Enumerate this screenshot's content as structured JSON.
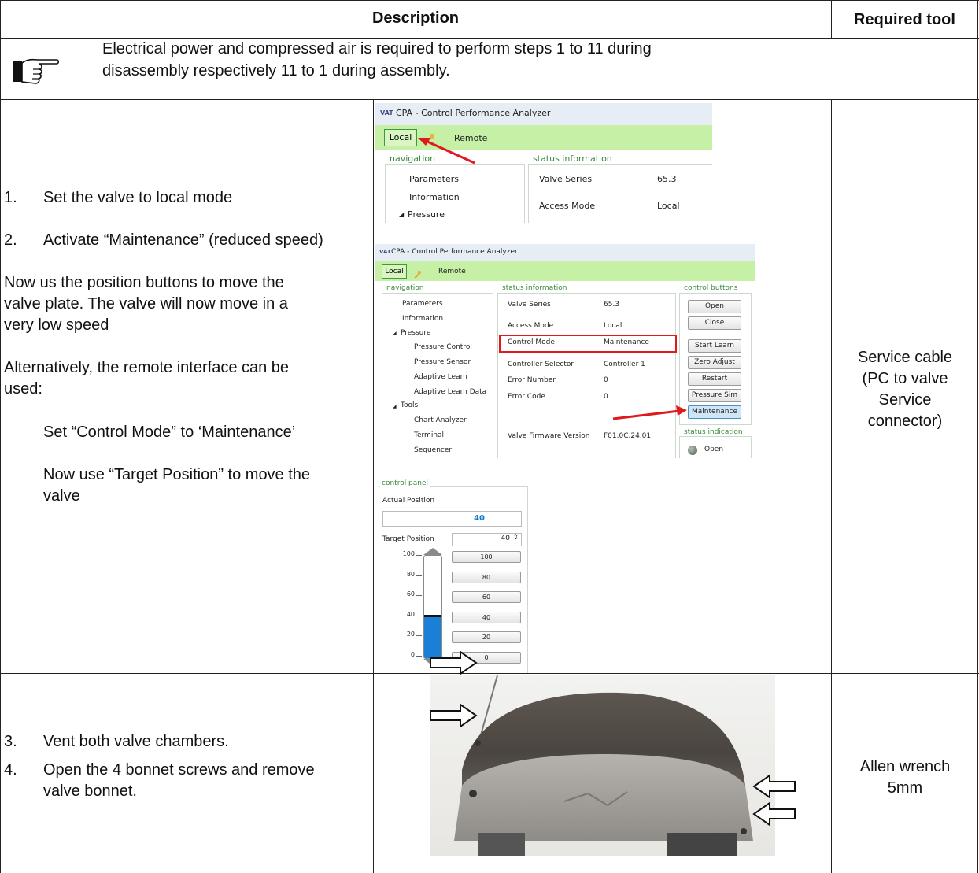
{
  "header": {
    "description": "Description",
    "required_tool": "Required tool"
  },
  "note": {
    "icon": "pointing-hand-icon",
    "line1": "Electrical power and compressed air is required to perform steps 1 to 11 during",
    "line2": "disassembly respectively 11 to 1 during assembly."
  },
  "row2": {
    "step1_num": "1.",
    "step1": "Set the valve to local mode",
    "step2_num": "2.",
    "step2": "Activate “Maintenance” (reduced speed)",
    "para1_l1": "Now us the position buttons to move the",
    "para1_l2": "valve plate. The valve will now move in a",
    "para1_l3": "very low speed",
    "para2_l1": "Alternatively, the remote interface can be",
    "para2_l2": "used:",
    "set_line": "Set “Control Mode” to ‘Maintenance’",
    "use_l1": "Now use “Target Position” to move the",
    "use_l2": "valve",
    "tool_l1": "Service cable",
    "tool_l2": "(PC to valve",
    "tool_l3": "Service",
    "tool_l4": "connector)"
  },
  "shot1": {
    "title": "CPA - Control Performance Analyzer",
    "logo": "VAT",
    "local": "Local",
    "remote": "Remote",
    "nav_label": "navigation",
    "nav": [
      "Parameters",
      "Information",
      "Pressure"
    ],
    "status_label": "status information",
    "status": [
      {
        "k": "Valve Series",
        "v": "65.3"
      },
      {
        "k": "Access Mode",
        "v": "Local"
      }
    ]
  },
  "shot2": {
    "title": "CPA - Control Performance Analyzer",
    "logo": "VAT",
    "local": "Local",
    "remote": "Remote",
    "nav_label": "navigation",
    "nav": [
      "Parameters",
      "Information",
      "Pressure",
      "Pressure Control",
      "Pressure Sensor",
      "Adaptive Learn",
      "Adaptive Learn Data",
      "Tools",
      "Chart Analyzer",
      "Terminal",
      "Sequencer"
    ],
    "status_label": "status information",
    "status": [
      {
        "k": "Valve Series",
        "v": "65.3"
      },
      {
        "k": "Access Mode",
        "v": "Local"
      },
      {
        "k": "Control Mode",
        "v": "Maintenance"
      },
      {
        "k": "Controller Selector",
        "v": "Controller 1"
      },
      {
        "k": "Error Number",
        "v": "0"
      },
      {
        "k": "Error Code",
        "v": "0"
      },
      {
        "k": "Valve Firmware Version",
        "v": "F01.0C.24.01"
      }
    ],
    "control_label": "control buttons",
    "buttons": [
      "Open",
      "Close",
      "Start Learn",
      "Zero Adjust",
      "Restart",
      "Pressure Sim",
      "Maintenance"
    ],
    "status_ind_label": "status indication",
    "status_ind": "Open"
  },
  "shot3": {
    "panel_label": "control panel",
    "actual_label": "Actual Position",
    "actual_value": "40",
    "target_label": "Target Position",
    "target_value": "40",
    "scale": [
      "100",
      "80",
      "60",
      "40",
      "20",
      "0"
    ],
    "presets": [
      "100",
      "80",
      "60",
      "40",
      "20",
      "0"
    ],
    "fill_fraction": 0.4
  },
  "row3": {
    "step3_num": "3.",
    "step3": "Vent both valve chambers.",
    "step4_num": "4.",
    "step4_l1": "Open the 4 bonnet screws and remove",
    "step4_l2": "valve bonnet.",
    "tool_l1": "Allen wrench",
    "tool_l2": "5mm"
  }
}
